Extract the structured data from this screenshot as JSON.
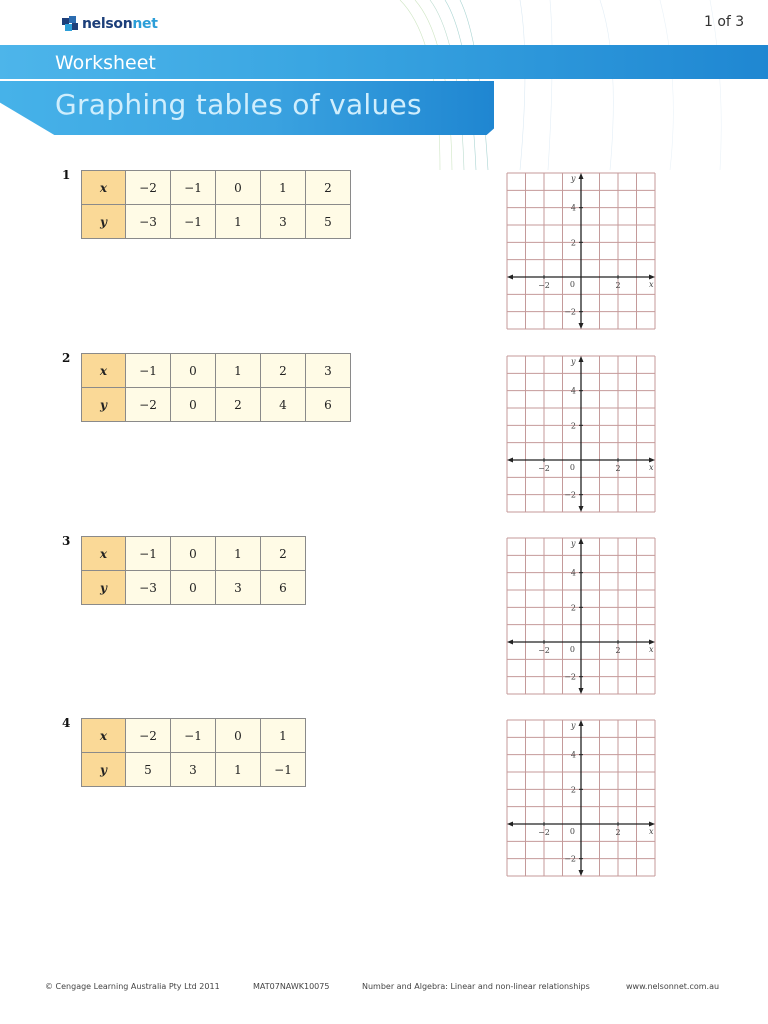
{
  "header": {
    "logo": {
      "part1": "nelson",
      "part2": "net"
    },
    "page_indicator": "1 of 3",
    "banner_label": "Worksheet",
    "title": "Graphing tables of values"
  },
  "table_headers": {
    "x": "x",
    "y": "y"
  },
  "questions": [
    {
      "number": "1",
      "x": [
        "−2",
        "−1",
        "0",
        "1",
        "2"
      ],
      "y": [
        "−3",
        "−1",
        "1",
        "3",
        "5"
      ]
    },
    {
      "number": "2",
      "x": [
        "−1",
        "0",
        "1",
        "2",
        "3"
      ],
      "y": [
        "−2",
        "0",
        "2",
        "4",
        "6"
      ]
    },
    {
      "number": "3",
      "x": [
        "−1",
        "0",
        "1",
        "2"
      ],
      "y": [
        "−3",
        "0",
        "3",
        "6"
      ]
    },
    {
      "number": "4",
      "x": [
        "−2",
        "−1",
        "0",
        "1"
      ],
      "y": [
        "5",
        "3",
        "1",
        "−1"
      ]
    }
  ],
  "grid": {
    "x_range": [
      -4,
      4
    ],
    "y_range": [
      -3,
      6
    ],
    "x_label": "x",
    "y_label": "y",
    "origin_label": "0",
    "x_tick_labels": [
      {
        "value": -2,
        "label": "−2"
      },
      {
        "value": 2,
        "label": "2"
      }
    ],
    "y_tick_labels": [
      {
        "value": 4,
        "label": "4"
      },
      {
        "value": 2,
        "label": "2"
      },
      {
        "value": -2,
        "label": "−2"
      }
    ],
    "grid_color": "#c49a9a",
    "axis_color": "#222222"
  },
  "footer": {
    "copyright": "© Cengage Learning Australia Pty Ltd 2011",
    "code": "MAT07NAWK10075",
    "topic": "Number and Algebra: Linear and non-linear relationships",
    "website": "www.nelsonnet.com.au"
  },
  "colors": {
    "banner": "#3aa6e2",
    "title_text": "#cfeefd",
    "table_header_fill": "#fad997",
    "table_cell_fill": "#fffbe6"
  }
}
